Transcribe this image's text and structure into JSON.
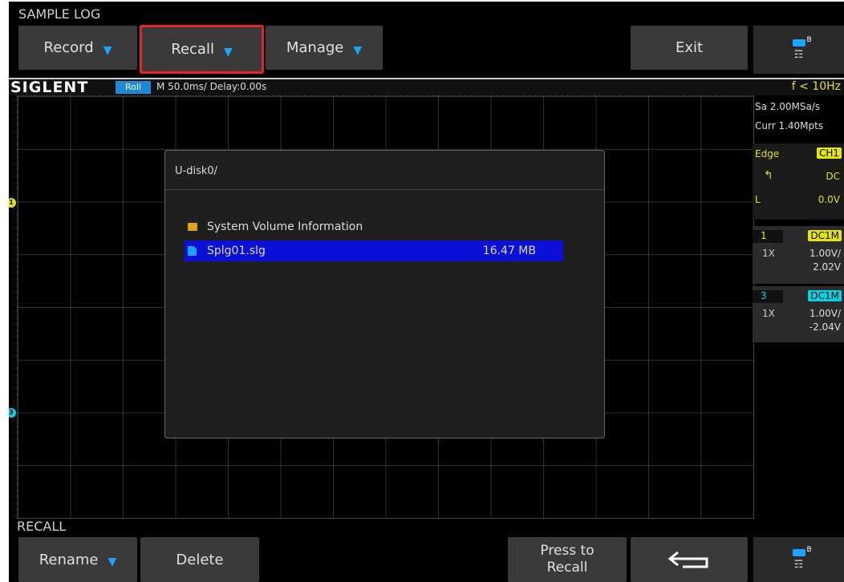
{
  "top_menu": {
    "title": "SAMPLE LOG",
    "buttons": [
      {
        "label": "Record"
      },
      {
        "label": "Recall"
      },
      {
        "label": "Manage"
      },
      {
        "label": "Exit"
      }
    ]
  },
  "status_bar": {
    "brand": "SIGLENT",
    "mode": "Roll",
    "timebase": "M 50.0ms/ Delay:0.00s",
    "freq": "f < 10Hz"
  },
  "right_panel": {
    "sample_rate": "Sa 2.00MSa/s",
    "memory": "Curr 1.40Mpts",
    "trigger": {
      "type": "Edge",
      "source": "CH1",
      "coupling": "DC",
      "level_label": "L",
      "level": "0.0V"
    },
    "channels": [
      {
        "num": "1",
        "coupling": "DC1M",
        "probe": "1X",
        "scale": "1.00V/",
        "offset": "2.02V",
        "color": "#e6e600"
      },
      {
        "num": "3",
        "coupling": "DC1M",
        "probe": "1X",
        "scale": "1.00V/",
        "offset": "-2.04V",
        "color": "#00d5e6"
      }
    ]
  },
  "dialog": {
    "path": "U-disk0/",
    "files": [
      {
        "name": "System Volume Information",
        "size": "",
        "icon": "folder-icon"
      },
      {
        "name": "Splg01.slg",
        "size": "16.47 MB",
        "icon": "file-icon"
      }
    ]
  },
  "bottom_menu": {
    "title": "RECALL",
    "buttons": [
      {
        "label": "Rename"
      },
      {
        "label": "Delete"
      },
      {
        "label_line1": "Press to",
        "label_line2": "Recall"
      }
    ]
  }
}
